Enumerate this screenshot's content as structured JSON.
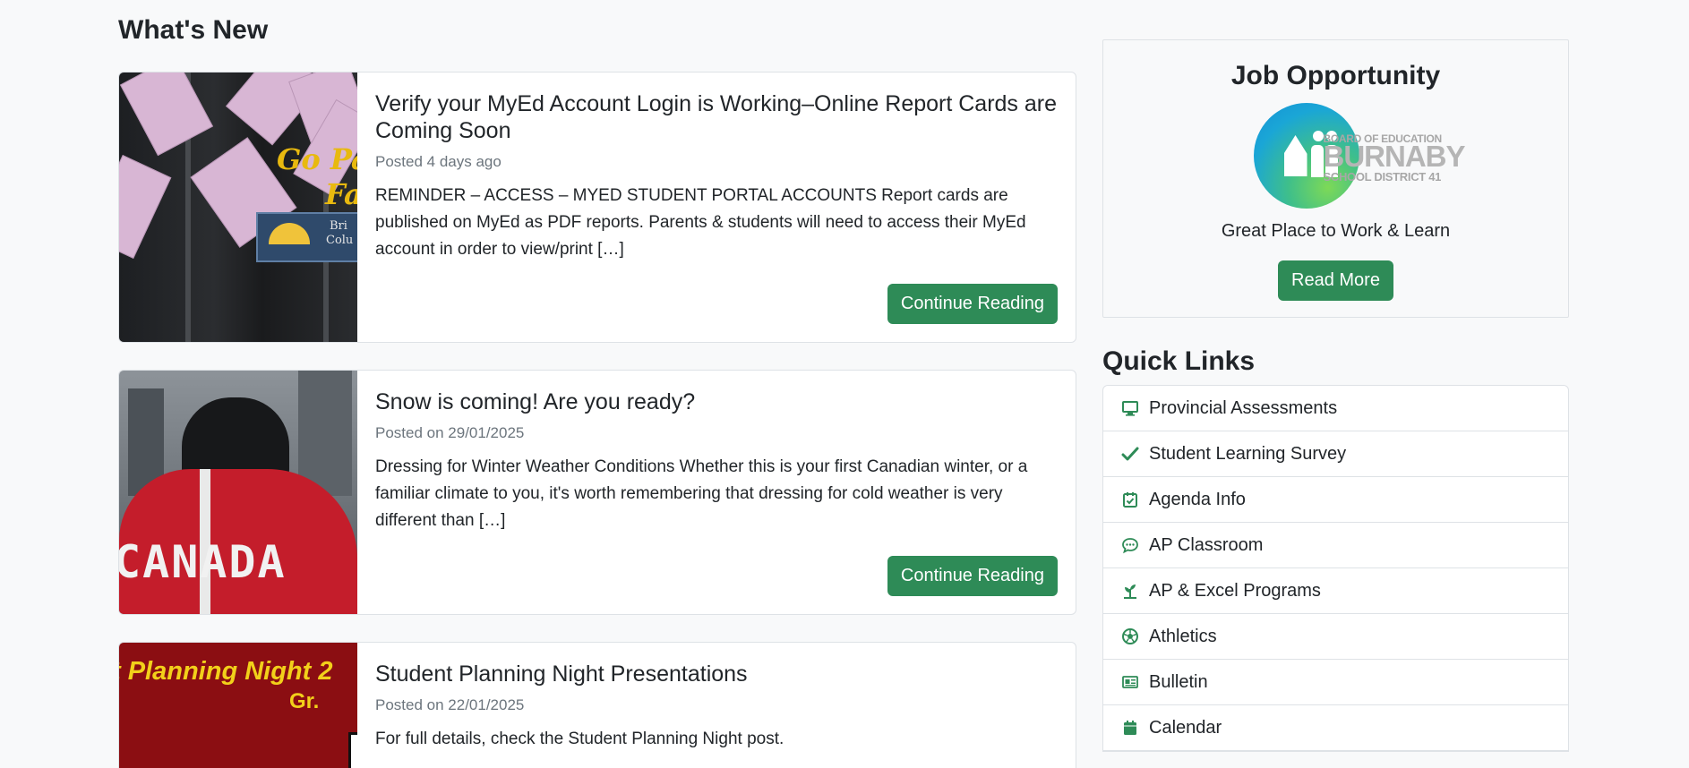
{
  "main": {
    "title": "What's New",
    "posts": [
      {
        "title": "Verify your MyEd Account Login is Working–Online Report Cards are Coming Soon",
        "date": "Posted 4 days ago",
        "excerpt": "REMINDER – ACCESS – MYED STUDENT PORTAL ACCOUNTS Report cards are published on MyEd as PDF reports. Parents & students will need to access their MyEd account in order to view/print […]",
        "button": "Continue Reading",
        "image_text": [
          "Go Pap",
          "Fa",
          "Bri",
          "Colu"
        ]
      },
      {
        "title": "Snow is coming! Are you ready?",
        "date": "Posted on 29/01/2025",
        "excerpt": "Dressing for Winter Weather Conditions Whether this is your first Canadian winter, or a familiar climate to you, it's worth remembering that dressing for cold weather is very different than […]",
        "button": "Continue Reading",
        "image_text": [
          "CANADA"
        ]
      },
      {
        "title": "Student Planning Night Presentations",
        "date": "Posted on 22/01/2025",
        "excerpt": "For full details, check the Student Planning Night post.",
        "image_text": [
          "t Planning Night 2",
          "Gr."
        ]
      }
    ]
  },
  "sidebar": {
    "job": {
      "title": "Job Opportunity",
      "logo_lines": [
        "BOARD OF EDUCATION",
        "BURNABY",
        "SCHOOL DISTRICT 41"
      ],
      "tagline": "Great Place to Work & Learn",
      "button": "Read More"
    },
    "quick_links": {
      "title": "Quick Links",
      "items": [
        {
          "label": "Provincial Assessments",
          "icon": "monitor-icon"
        },
        {
          "label": "Student Learning Survey",
          "icon": "checkmark-icon"
        },
        {
          "label": "Agenda Info",
          "icon": "calendar-check-icon"
        },
        {
          "label": "AP Classroom",
          "icon": "chat-bubble-icon"
        },
        {
          "label": "AP & Excel Programs",
          "icon": "sprout-icon"
        },
        {
          "label": "Athletics",
          "icon": "soccer-ball-icon"
        },
        {
          "label": "Bulletin",
          "icon": "newspaper-icon"
        },
        {
          "label": "Calendar",
          "icon": "calendar-icon"
        }
      ]
    }
  },
  "colors": {
    "accent_green": "#2e8b57",
    "background": "#f8f9fa",
    "border": "#dee2e6",
    "muted_text": "#6c757d"
  }
}
